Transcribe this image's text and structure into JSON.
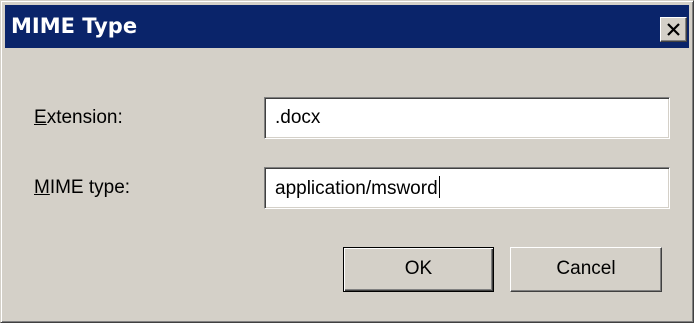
{
  "dialog": {
    "title": "MIME Type"
  },
  "form": {
    "extension": {
      "label_accel": "E",
      "label_rest": "xtension:",
      "value": ".docx"
    },
    "mime_type": {
      "label_accel": "M",
      "label_rest": "IME type:",
      "value": "application/msword"
    }
  },
  "buttons": {
    "ok_label": "OK",
    "cancel_label": "Cancel"
  },
  "icons": {
    "close": "close-icon"
  },
  "colors": {
    "titlebar": "#0a246a",
    "dialog_face": "#d4d0c8"
  }
}
